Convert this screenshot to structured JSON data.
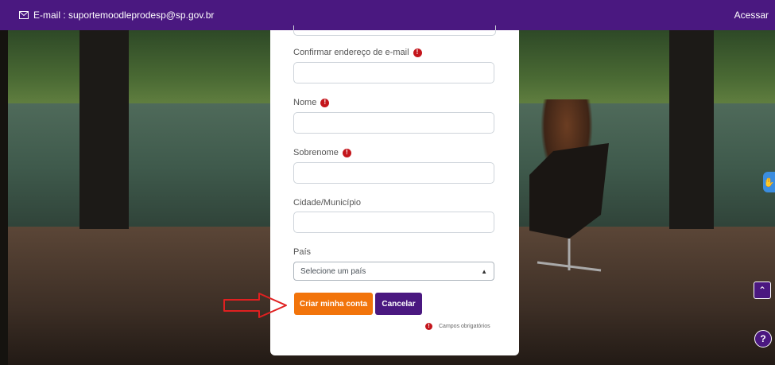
{
  "topbar": {
    "email_text": "E-mail : suportemoodleprodesp@sp.gov.br",
    "login_label": "Acessar"
  },
  "form": {
    "confirm_email_label": "Confirmar endereço de e-mail",
    "first_name_label": "Nome",
    "last_name_label": "Sobrenome",
    "city_label": "Cidade/Município",
    "country_label": "País",
    "country_selected": "Selecione um país",
    "required_mark": "!",
    "submit_label": "Criar minha conta",
    "cancel_label": "Cancelar",
    "required_note": "Campos obrigatórios"
  },
  "side": {
    "scroll_top_glyph": "⌃",
    "help_glyph": "?",
    "accessibility_glyph": "✋"
  },
  "colors": {
    "brand_purple": "#4a1880",
    "primary_orange": "#f2740b",
    "required_red": "#c4161c"
  }
}
